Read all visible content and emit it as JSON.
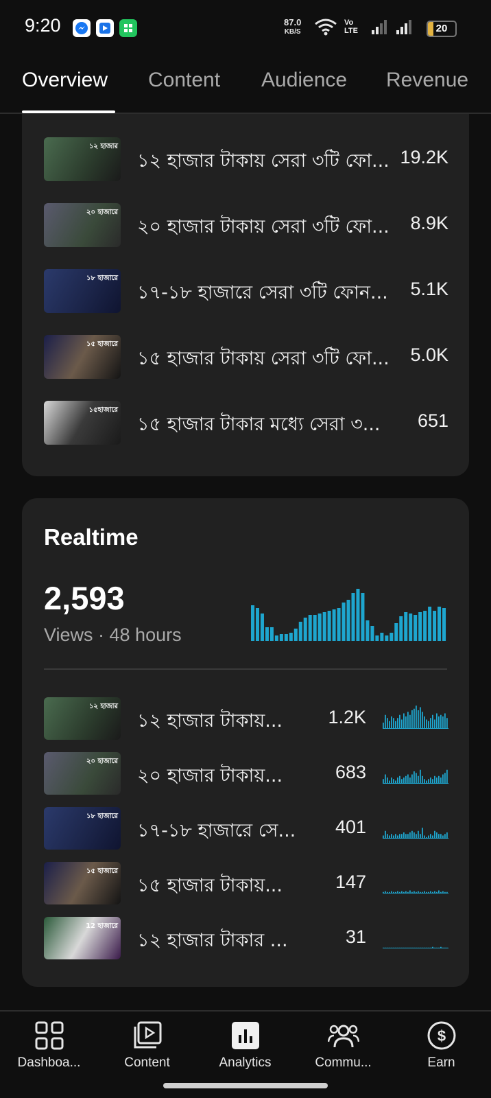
{
  "status_bar": {
    "time": "9:20",
    "speed_value": "87.0",
    "speed_unit": "KB/S",
    "network_label": "Vo LTE",
    "battery": "20",
    "battery_level": 0.2,
    "app_icons": [
      "messenger-icon",
      "news-app-icon",
      "app-grid-icon"
    ]
  },
  "tabs": [
    {
      "label": "Overview",
      "active": true
    },
    {
      "label": "Content",
      "active": false
    },
    {
      "label": "Audience",
      "active": false
    },
    {
      "label": "Revenue",
      "active": false
    }
  ],
  "top_content": [
    {
      "title": "১২ হাজার টাকায় সেরা ৩টি ফো...",
      "value": "19.2K",
      "thumb": "১২ হাজার"
    },
    {
      "title": "২০ হাজার টাকায় সেরা ৩টি ফো...",
      "value": "8.9K",
      "thumb": "২০ হাজারে"
    },
    {
      "title": "১৭-১৮ হাজারে সেরা ৩টি ফোন...",
      "value": "5.1K",
      "thumb": "১৮ হাজারে"
    },
    {
      "title": "১৫ হাজার টাকায় সেরা ৩টি ফো...",
      "value": "5.0K",
      "thumb": "১৫ হাজারে"
    },
    {
      "title": "১৫ হাজার টাকার মধ্যে সেরা ৩...",
      "value": "651",
      "thumb": "১৫হাজারে"
    }
  ],
  "realtime": {
    "title": "Realtime",
    "views": "2,593",
    "subtitle": "Views · 48 hours",
    "chart_data": {
      "type": "bar",
      "values": [
        52,
        48,
        40,
        20,
        20,
        8,
        10,
        10,
        12,
        18,
        28,
        34,
        38,
        38,
        40,
        42,
        44,
        46,
        48,
        56,
        60,
        70,
        76,
        70,
        30,
        22,
        8,
        12,
        8,
        12,
        26,
        36,
        42,
        40,
        38,
        42,
        44,
        50,
        44,
        50,
        48
      ],
      "ylim": [
        0,
        80
      ]
    },
    "items": [
      {
        "title": "১২ হাজার টাকায়...",
        "value": "1.2K",
        "thumb": "১২ হাজার",
        "spark": [
          8,
          18,
          14,
          10,
          16,
          14,
          10,
          14,
          18,
          12,
          20,
          16,
          22,
          18,
          24,
          26,
          30,
          24,
          28,
          22,
          16,
          12,
          10,
          14,
          18,
          12,
          20,
          16,
          18,
          16,
          20,
          14
        ]
      },
      {
        "title": "২০ হাজার টাকায়...",
        "value": "683",
        "thumb": "২০ হাজারে",
        "spark": [
          6,
          12,
          8,
          4,
          8,
          6,
          4,
          8,
          10,
          6,
          8,
          10,
          12,
          8,
          12,
          16,
          14,
          10,
          18,
          10,
          6,
          4,
          6,
          8,
          6,
          10,
          8,
          10,
          8,
          12,
          14,
          18
        ]
      },
      {
        "title": "১৭-১৮ হাজারে সে...",
        "value": "401",
        "thumb": "১৮ হাজারে",
        "spark": [
          4,
          10,
          6,
          4,
          6,
          4,
          6,
          4,
          6,
          6,
          8,
          6,
          6,
          8,
          10,
          8,
          6,
          10,
          6,
          14,
          4,
          2,
          4,
          6,
          4,
          10,
          8,
          6,
          6,
          4,
          6,
          8
        ]
      },
      {
        "title": "১৫ হাজার টাকায়...",
        "value": "147",
        "thumb": "১৫ হাজারে",
        "spark": [
          2,
          3,
          2,
          2,
          3,
          2,
          2,
          3,
          2,
          3,
          2,
          3,
          2,
          4,
          2,
          3,
          2,
          3,
          2,
          2,
          3,
          2,
          2,
          3,
          2,
          3,
          2,
          4,
          2,
          3,
          2,
          2
        ]
      },
      {
        "title": "১২ হাজার টাকার ...",
        "value": "31",
        "thumb": "12 হাজারে",
        "spark": [
          1,
          1,
          1,
          1,
          1,
          1,
          1,
          1,
          1,
          1,
          1,
          1,
          1,
          1,
          1,
          1,
          1,
          1,
          1,
          1,
          1,
          1,
          1,
          1,
          2,
          1,
          1,
          1,
          2,
          1,
          1,
          1
        ]
      }
    ]
  },
  "bottom_nav": [
    {
      "label": "Dashboa...",
      "icon": "dashboard-icon"
    },
    {
      "label": "Content",
      "icon": "content-icon"
    },
    {
      "label": "Analytics",
      "icon": "analytics-icon"
    },
    {
      "label": "Commu...",
      "icon": "community-icon"
    },
    {
      "label": "Earn",
      "icon": "earn-icon"
    }
  ],
  "colors": {
    "accent_bar": "#1ea6cf",
    "card": "#212121",
    "background": "#0f0f0f"
  }
}
